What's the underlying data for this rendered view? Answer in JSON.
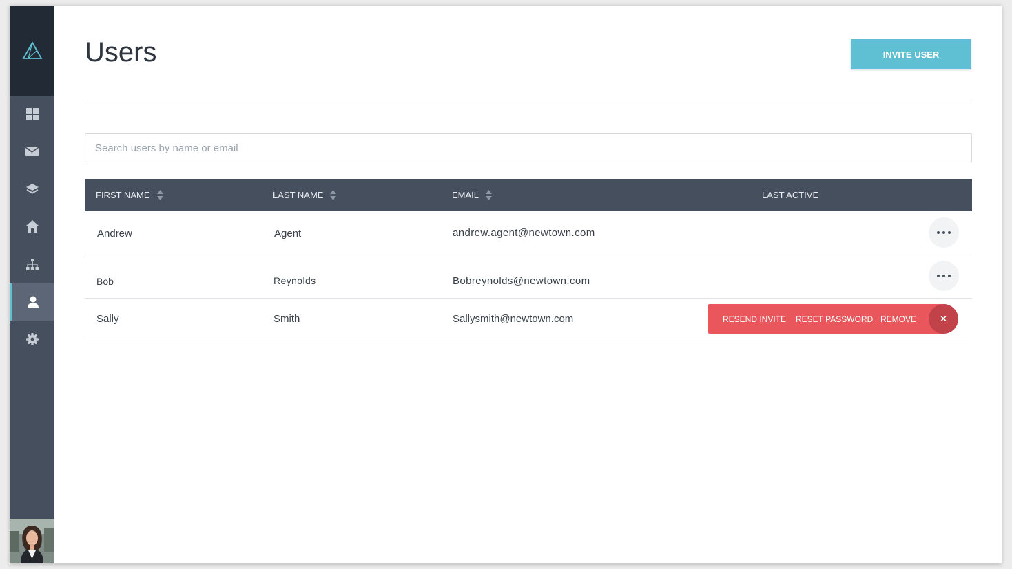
{
  "page": {
    "title": "Users",
    "invite_button": "INVITE USER",
    "search_placeholder": "Search users by name or email"
  },
  "sidebar": {
    "items": [
      {
        "icon": "dashboard-icon"
      },
      {
        "icon": "mail-icon"
      },
      {
        "icon": "layers-icon"
      },
      {
        "icon": "home-icon"
      },
      {
        "icon": "sitemap-icon"
      },
      {
        "icon": "user-icon",
        "active": true
      },
      {
        "icon": "gear-icon"
      }
    ]
  },
  "table": {
    "columns": [
      "FIRST NAME",
      "LAST NAME",
      "EMAIL",
      "LAST ACTIVE"
    ],
    "rows": [
      {
        "first": "Andrew",
        "last": "Agent",
        "email": "andrew.agent@newtown.com",
        "last_active": ""
      },
      {
        "first": "Bob",
        "last": "Reynolds",
        "email": "Bobreynolds@newtown.com",
        "last_active": ""
      },
      {
        "first": "Sally",
        "last": "Smith",
        "email": "Sallysmith@newtown.com",
        "last_active": ""
      }
    ],
    "row_actions": {
      "resend": "RESEND INVITE",
      "reset": "RESET PASSWORD",
      "remove": "REMOVE",
      "close": "×"
    }
  },
  "colors": {
    "sidebar": "#454f5e",
    "sidebar_top": "#222a35",
    "accent": "#5fbfd3",
    "danger": "#e9565b",
    "danger_dark": "#c2424a"
  }
}
